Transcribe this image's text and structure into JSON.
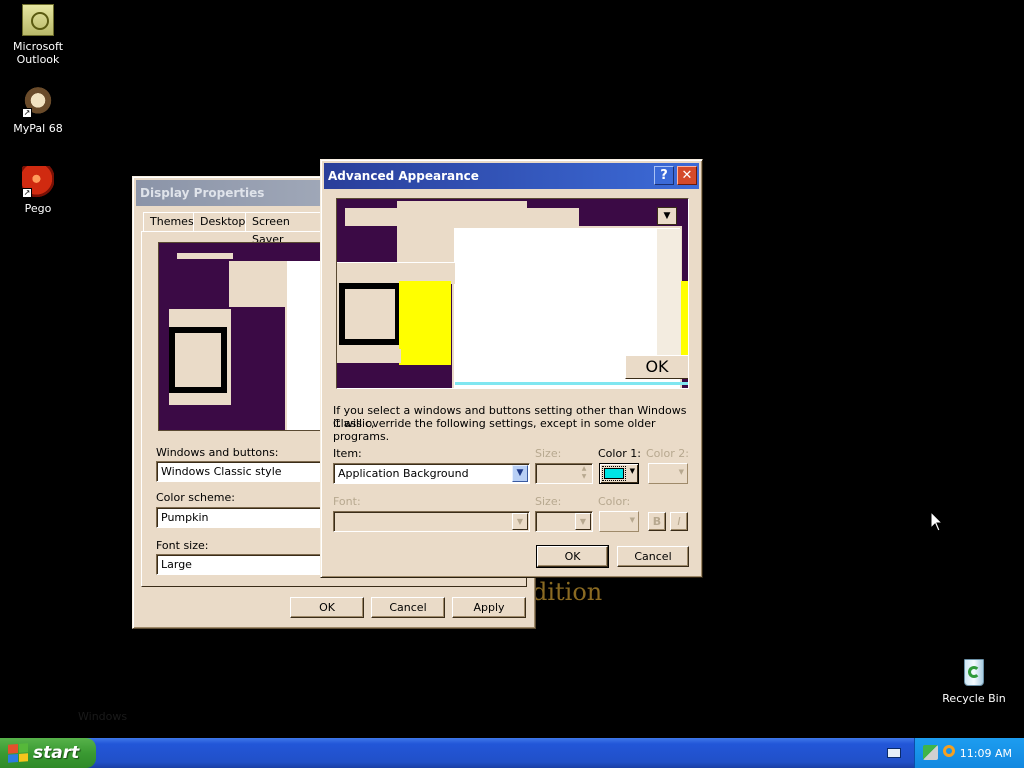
{
  "desktop": {
    "icons": [
      {
        "label": "Microsoft Outlook",
        "icon": "outlook-icon"
      },
      {
        "label": "MyPal 68",
        "icon": "mypal-icon"
      },
      {
        "label": "Pego",
        "icon": "pego-icon"
      },
      {
        "label": "Recycle Bin",
        "icon": "recycle-bin-icon"
      }
    ],
    "wallpaper_text": "dition",
    "wallpaper_faint_text": "Windows"
  },
  "display_properties": {
    "title": "Display Properties",
    "tabs": [
      "Themes",
      "Desktop",
      "Screen Saver"
    ],
    "windows_buttons_label": "Windows and buttons:",
    "windows_buttons_value": "Windows Classic style",
    "color_scheme_label": "Color scheme:",
    "color_scheme_value": "Pumpkin",
    "font_size_label": "Font size:",
    "font_size_value": "Large",
    "ok": "OK",
    "cancel": "Cancel",
    "apply": "Apply"
  },
  "advanced": {
    "title": "Advanced Appearance",
    "help_symbol": "?",
    "close_symbol": "✕",
    "preview_ok": "OK",
    "info_line1": "If you select a windows and buttons setting other than Windows Classic,",
    "info_line2": "it will override the following settings, except in some older programs.",
    "item_label": "Item:",
    "item_value": "Application Background",
    "size_label": "Size:",
    "color1_label": "Color 1:",
    "color2_label": "Color 2:",
    "font_label": "Font:",
    "font_size_label": "Size:",
    "font_color_label": "Color:",
    "bold": "B",
    "italic": "I",
    "ok": "OK",
    "cancel": "Cancel",
    "color1_swatch": "#00e5e5"
  },
  "taskbar": {
    "start": "start",
    "clock": "11:09 AM"
  },
  "colors": {
    "scheme_face": "#eadbc8",
    "scheme_desktop": "#3b0a45",
    "title_active": "#2a3f9a"
  }
}
